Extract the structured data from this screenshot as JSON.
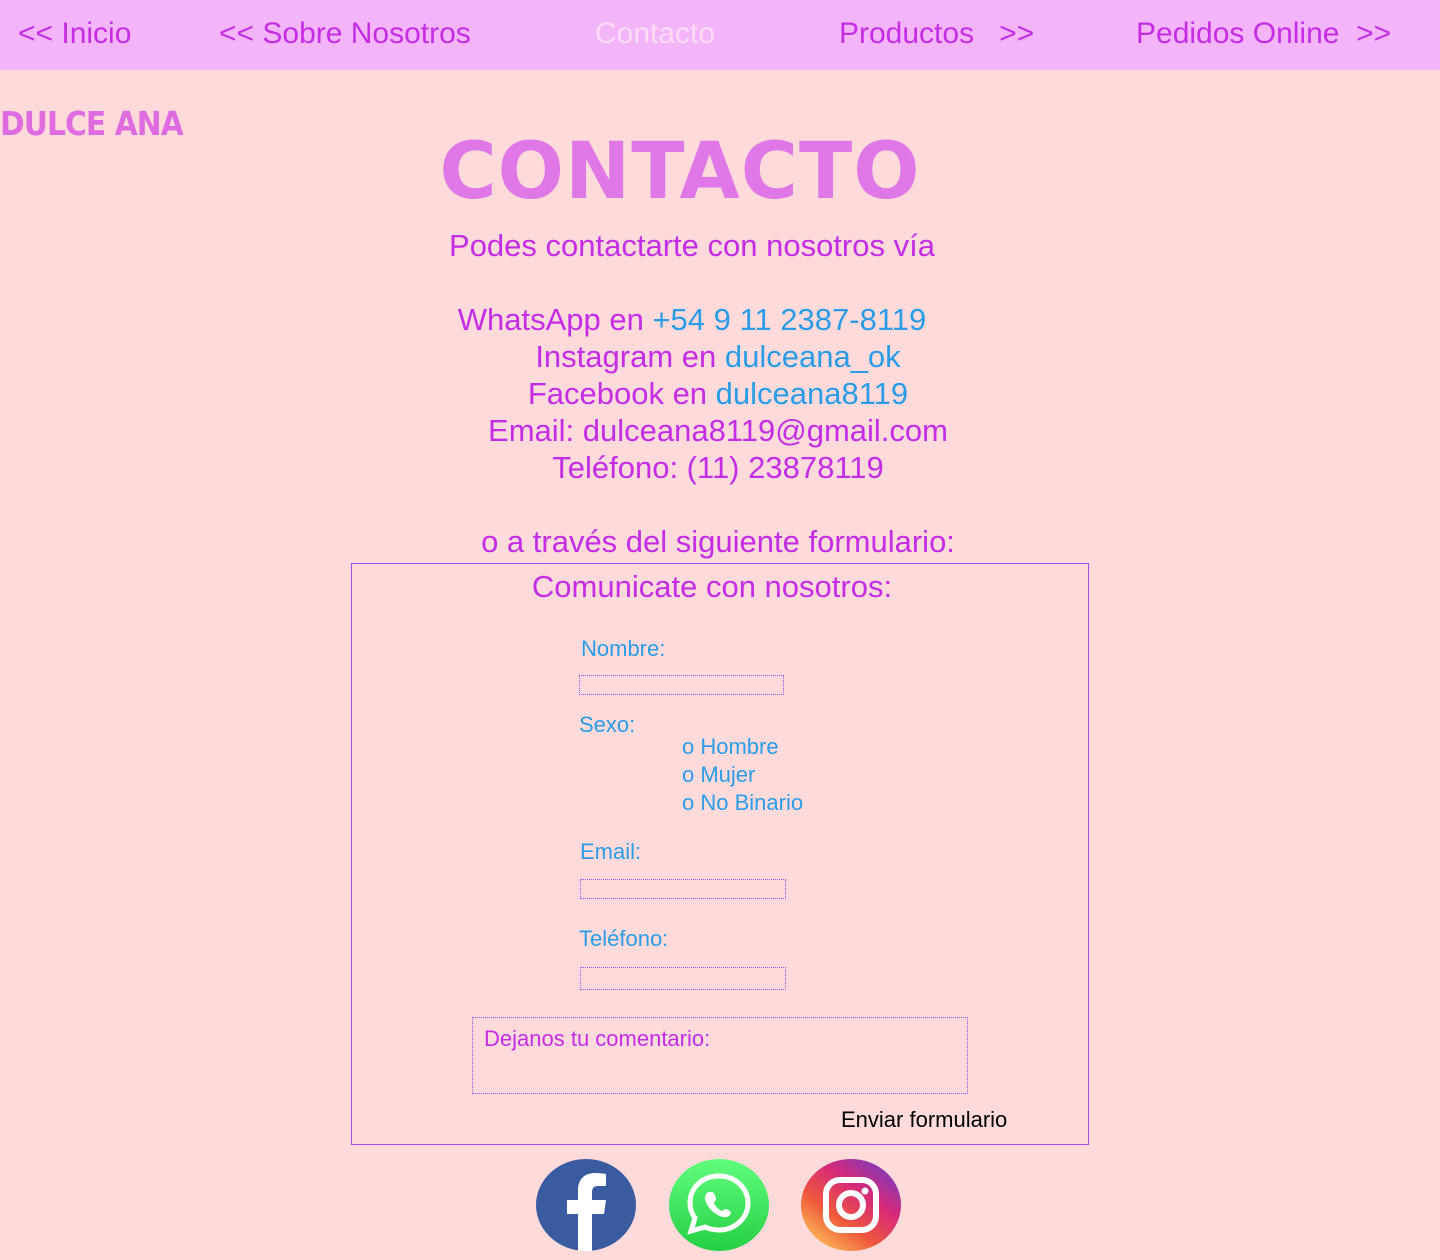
{
  "nav": {
    "inicio": "<< Inicio",
    "sobre": "<< Sobre Nosotros",
    "contacto": "Contacto",
    "productos": "Productos   >>",
    "pedidos": "Pedidos Online  >>"
  },
  "brand": {
    "logo": "Dulce Ana"
  },
  "page": {
    "title": "Contacto"
  },
  "contact": {
    "intro": "Podes contactarte con nosotros vía",
    "whatsapp_prefix": "WhatsApp en ",
    "whatsapp_value": "+54 9 11 2387-8119",
    "instagram_prefix": "Instagram en ",
    "instagram_value": "dulceana_ok",
    "facebook_prefix": "Facebook en ",
    "facebook_value": "dulceana8119",
    "email_line": "Email: dulceana8119@gmail.com",
    "phone_line": "Teléfono: (11) 23878119",
    "form_intro": "o a través del siguiente formulario:"
  },
  "form": {
    "title": "Comunicate con nosotros:",
    "name_label": "Nombre:",
    "name_value": "",
    "sex_label": "Sexo:",
    "sex_options": [
      "o Hombre",
      "o Mujer",
      "o No Binario"
    ],
    "email_label": "Email:",
    "email_value": "",
    "phone_label": "Teléfono:",
    "phone_value": "",
    "comment_placeholder": "Dejanos tu comentario:",
    "submit_label": "Enviar formulario"
  },
  "social": [
    "facebook-icon",
    "whatsapp-icon",
    "instagram-icon"
  ],
  "colors": {
    "background": "#fedadb",
    "nav_background": "#f4b4f9",
    "primary_text": "#c42de4",
    "link_text": "#2a9de6",
    "title": "#df77e6",
    "border": "#a04dea"
  }
}
